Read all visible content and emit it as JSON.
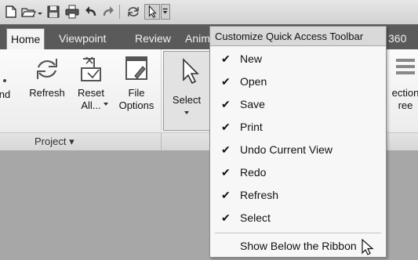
{
  "tabs": [
    {
      "label": "Home",
      "active": true
    },
    {
      "label": "Viewpoint",
      "active": false
    },
    {
      "label": "Review",
      "active": false
    },
    {
      "label": "Anim",
      "active": false
    },
    {
      "label": "360",
      "active": false
    }
  ],
  "ribbon": {
    "buttons": [
      {
        "label": "nd"
      },
      {
        "label": "Refresh"
      },
      {
        "label": "Reset All...",
        "line1": "Reset",
        "line2": "All..."
      },
      {
        "label": "File Options",
        "line1": "File",
        "line2": "Options"
      },
      {
        "label": "Select"
      },
      {
        "label": "ection ree",
        "line1": "ection",
        "line2": "ree"
      }
    ],
    "group_label": "Project ▾"
  },
  "menu": {
    "title": "Customize Quick Access Toolbar",
    "items": [
      {
        "label": "New",
        "checked": true
      },
      {
        "label": "Open",
        "checked": true
      },
      {
        "label": "Save",
        "checked": true
      },
      {
        "label": "Print",
        "checked": true
      },
      {
        "label": "Undo Current View",
        "checked": true
      },
      {
        "label": "Redo",
        "checked": true
      },
      {
        "label": "Refresh",
        "checked": true
      },
      {
        "label": "Select",
        "checked": true
      }
    ],
    "show_below": "Show Below the Ribbon",
    "check_glyph": "✔"
  },
  "icons": [
    "new-icon",
    "open-icon",
    "save-icon",
    "print-icon",
    "undo-icon",
    "redo-icon",
    "refresh-icon",
    "select-icon",
    "customize-dropdown-icon"
  ]
}
